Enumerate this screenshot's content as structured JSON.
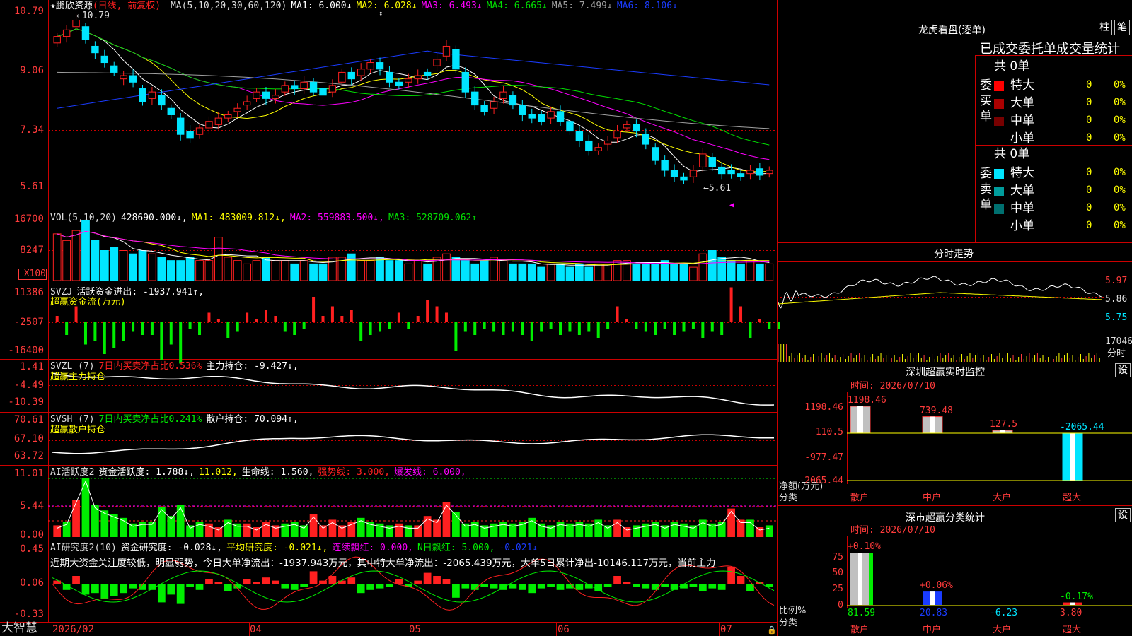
{
  "colors": {
    "up": "#ff2020",
    "down": "#00e5ff",
    "border": "#cc0000",
    "ma1": "#ffffff",
    "ma2": "#ffff00",
    "ma3": "#ff00ff",
    "ma4": "#00e000",
    "ma5": "#a0a0a0",
    "ma6": "#1a3cff",
    "green": "#00ee00",
    "red": "#ff2020",
    "yellow": "#ffff00",
    "magenta": "#ff00ff",
    "blue": "#1a3cff",
    "cyan": "#00e5ff"
  },
  "kline": {
    "title": "★鹏欣资源",
    "period": "(日线, 前复权)",
    "ma_params": "MA(5,10,20,30,60,120)",
    "ma_values": [
      {
        "label": "MA1: 6.000",
        "arrow": "↓",
        "color": "#ffffff"
      },
      {
        "label": "MA2: 6.028",
        "arrow": "↓",
        "color": "#ffff00"
      },
      {
        "label": "MA3: 6.493",
        "arrow": "↓",
        "color": "#ff00ff"
      },
      {
        "label": "MA4: 6.665",
        "arrow": "↓",
        "color": "#00e000"
      },
      {
        "label": "MA5: 7.499",
        "arrow": "↓",
        "color": "#a0a0a0"
      },
      {
        "label": "MA6: 8.106",
        "arrow": "↓",
        "color": "#1a3cff"
      }
    ],
    "yticks": [
      "10.79",
      "9.06",
      "7.34",
      "5.61"
    ],
    "high_label": "←10.79",
    "low_label": "←5.61",
    "price_min": 5.2,
    "price_max": 11.0,
    "closes": [
      10.1,
      10.3,
      10.6,
      10.0,
      9.6,
      9.3,
      9.0,
      8.9,
      8.7,
      8.1,
      8.4,
      8.0,
      7.7,
      7.1,
      7.0,
      7.3,
      7.5,
      7.6,
      7.7,
      7.9,
      8.1,
      8.4,
      8.2,
      8.3,
      8.6,
      8.5,
      8.7,
      8.4,
      8.3,
      8.6,
      9.0,
      8.8,
      9.1,
      9.3,
      9.1,
      8.7,
      8.6,
      8.8,
      8.9,
      8.9,
      9.4,
      9.8,
      9.1,
      8.4,
      8.0,
      7.8,
      8.1,
      8.4,
      8.0,
      7.7,
      7.6,
      7.5,
      7.8,
      7.5,
      7.2,
      6.9,
      6.6,
      6.7,
      6.9,
      7.2,
      7.4,
      7.2,
      6.8,
      6.3,
      6.0,
      5.8,
      5.7,
      6.0,
      6.5,
      6.1,
      5.9,
      5.9,
      5.8,
      6.0,
      5.85,
      6.0
    ],
    "opens": [
      9.9,
      10.1,
      10.4,
      10.4,
      9.8,
      9.5,
      9.2,
      8.8,
      8.9,
      8.5,
      8.2,
      8.3,
      7.9,
      7.6,
      7.2,
      7.1,
      7.3,
      7.4,
      7.6,
      7.8,
      8.0,
      8.2,
      8.4,
      8.2,
      8.4,
      8.6,
      8.5,
      8.7,
      8.5,
      8.4,
      8.7,
      9.0,
      8.9,
      9.1,
      9.3,
      9.0,
      8.7,
      8.7,
      8.8,
      9.0,
      9.2,
      9.5,
      9.7,
      9.0,
      8.4,
      8.0,
      7.9,
      8.2,
      8.3,
      8.0,
      7.7,
      7.7,
      7.6,
      7.8,
      7.5,
      7.2,
      6.9,
      6.6,
      6.8,
      7.0,
      7.3,
      7.4,
      7.1,
      6.7,
      6.3,
      6.0,
      5.8,
      5.8,
      6.1,
      6.4,
      6.1,
      6.0,
      5.9,
      5.9,
      6.05,
      5.9
    ]
  },
  "vol": {
    "header": [
      {
        "label": "VOL(5,10,20)",
        "color": "#dddddd"
      },
      {
        "label": "428690.000↓,",
        "color": "#ffffff"
      },
      {
        "label": "MA1: 483009.812↓,",
        "color": "#ffff00"
      },
      {
        "label": "MA2: 559883.500↓,",
        "color": "#ff00ff"
      },
      {
        "label": "MA3: 528709.062↑",
        "color": "#00e000"
      }
    ],
    "yticks": [
      "16700",
      "8247",
      "X100"
    ],
    "values": [
      14,
      12,
      15,
      18,
      12,
      9,
      10,
      9,
      8,
      9,
      8,
      7,
      6,
      6,
      7,
      6,
      6,
      13,
      7,
      6,
      5,
      6,
      7,
      6,
      6,
      5,
      6,
      5,
      5,
      7,
      7,
      8,
      6,
      6,
      7,
      6,
      6,
      5,
      6,
      5,
      7,
      8,
      7,
      6,
      5,
      6,
      7,
      6,
      5,
      5,
      5,
      4,
      5,
      5,
      4,
      5,
      4,
      5,
      5,
      6,
      6,
      5,
      5,
      5,
      6,
      5,
      5,
      4,
      8,
      9,
      7,
      6,
      5,
      6,
      5,
      5
    ]
  },
  "svzj": {
    "header": [
      {
        "label": "SVZJ",
        "color": "#dddddd"
      },
      {
        "label": "活跃资金进出: -1937.941↑,",
        "color": "#ffffff"
      }
    ],
    "subtitle": "超赢资金流(万元)",
    "yticks": [
      "11386",
      "-2507",
      "-16400"
    ],
    "values": [
      2,
      -4,
      5,
      -7,
      -6,
      -10,
      -8,
      -6,
      -3,
      -4,
      -4,
      -12,
      -7,
      -13,
      -2,
      -4,
      3,
      1,
      -5,
      -3,
      3,
      1,
      4,
      2,
      -3,
      -4,
      -2,
      8,
      2,
      5,
      2,
      4,
      -6,
      -4,
      -3,
      -2,
      3,
      -2,
      2,
      7,
      5,
      3,
      -9,
      -3,
      -4,
      -2,
      -3,
      -4,
      -3,
      -4,
      -6,
      -3,
      -2,
      -4,
      -3,
      -4,
      -3,
      -5,
      -2,
      5,
      1,
      -2,
      -3,
      -4,
      -2,
      -4,
      -3,
      -2,
      -5,
      -3,
      -4,
      11,
      5,
      -5,
      1,
      -2,
      -2
    ]
  },
  "svzl": {
    "header": [
      {
        "label": "SVZL (7)",
        "color": "#dddddd"
      },
      {
        "label": "7日内买卖净占比0.536%",
        "color": "#ff2020"
      },
      {
        "label": "主力持仓: -9.427↓,",
        "color": "#ffffff"
      }
    ],
    "subtitle": "超赢主力持仓",
    "yticks": [
      "1.41",
      "-4.49",
      "-10.39"
    ]
  },
  "svsh": {
    "header": [
      {
        "label": "SVSH (7)",
        "color": "#dddddd"
      },
      {
        "label": "7日内买卖净占比0.241%",
        "color": "#00ee00"
      },
      {
        "label": "散户持仓: 70.094↑,",
        "color": "#ffffff"
      }
    ],
    "subtitle": "超赢散户持仓",
    "yticks": [
      "70.61",
      "67.10",
      "63.72"
    ]
  },
  "ai_active": {
    "header": [
      {
        "label": "AI活跃度2",
        "color": "#dddddd"
      },
      {
        "label": "资金活跃度: 1.788↓,",
        "color": "#ffffff"
      },
      {
        "label": "11.012,",
        "color": "#ffff00"
      },
      {
        "label": "生命线: 1.560,",
        "color": "#ffffff"
      },
      {
        "label": "强势线: 3.000,",
        "color": "#ff2020"
      },
      {
        "label": "爆发线: 6.000,",
        "color": "#ff00ff"
      }
    ],
    "yticks": [
      "11.01",
      "5.44",
      "0.00"
    ]
  },
  "ai_research": {
    "header": [
      {
        "label": "AI研究度2(10)",
        "color": "#dddddd"
      },
      {
        "label": "资金研究度: -0.028↓,",
        "color": "#ffffff"
      },
      {
        "label": "平均研究度: -0.021↓,",
        "color": "#ffff00"
      },
      {
        "label": "连续飘红: 0.000,",
        "color": "#ff00ff"
      },
      {
        "label": "N日飘红: 5.000,",
        "color": "#00ee00"
      },
      {
        "label": "-0.021↓",
        "color": "#1a3cff"
      }
    ],
    "comment": "近期大资金关注度较低，明显弱势，今日大单净流出：-1937.943万元，其中特大单净流出：-2065.439万元，大单5日累计净出-10146.117万元，当前主力",
    "yticks": [
      "0.45",
      "0.06",
      "-0.33"
    ]
  },
  "xaxis": {
    "labels": [
      "2026/02",
      "04",
      "05",
      "06",
      "07"
    ]
  },
  "logo": "大智慧",
  "right": {
    "longhu": {
      "title": "龙虎看盘(逐单)",
      "btn1": "柱",
      "btn2": "笔",
      "subtitle": "已成交委托单成交量统计",
      "buy": {
        "label": "委买单",
        "total": "共 0单",
        "rows": [
          {
            "name": "特大",
            "val": "0",
            "pct": "0%",
            "color": "#ff0000"
          },
          {
            "name": "大单",
            "val": "0",
            "pct": "0%",
            "color": "#aa0000"
          },
          {
            "name": "中单",
            "val": "0",
            "pct": "0%",
            "color": "#770000"
          },
          {
            "name": "小单",
            "val": "0",
            "pct": "0%",
            "color": "#000000"
          }
        ]
      },
      "sell": {
        "label": "委卖单",
        "total": "共 0单",
        "rows": [
          {
            "name": "特大",
            "val": "0",
            "pct": "0%",
            "color": "#00e5ff"
          },
          {
            "name": "大单",
            "val": "0",
            "pct": "0%",
            "color": "#009c9c"
          },
          {
            "name": "中单",
            "val": "0",
            "pct": "0%",
            "color": "#007070"
          },
          {
            "name": "小单",
            "val": "0",
            "pct": "0%",
            "color": "#000000"
          }
        ]
      }
    },
    "intraday": {
      "title": "分时走势",
      "yticks": [
        "5.97",
        "5.86",
        "5.75"
      ],
      "vol_label": "17046",
      "label": "分时"
    },
    "monitor": {
      "title": "深圳超赢实时监控",
      "btn": "设",
      "time": "时间: 2026/07/10",
      "yticks": [
        "1198.46",
        "110.5",
        "-977.47",
        "-2065.44"
      ],
      "ylabel1": "净额(万元)",
      "ylabel2": "分类",
      "categories": [
        "散户",
        "中户",
        "大户",
        "超大"
      ],
      "values": [
        1198.46,
        739.48,
        127.5,
        -2065.44
      ],
      "value_labels": [
        "1198.46",
        "739.48",
        "127.5",
        "-2065.44"
      ]
    },
    "stats": {
      "title": "深市超赢分类统计",
      "btn": "设",
      "time": "时间: 2026/07/10",
      "yticks": [
        "75",
        "50",
        "25",
        "0"
      ],
      "ylabel1": "比例%",
      "ylabel2": "分类",
      "categories": [
        "散户",
        "中户",
        "大户",
        "超大"
      ],
      "values": [
        81.59,
        20.83,
        -6.23,
        3.8
      ],
      "value_labels": [
        "81.59",
        "20.83",
        "-6.23",
        "3.80"
      ],
      "change_labels": [
        "+0.10%",
        "+0.06%",
        "",
        "-0.17%"
      ]
    }
  }
}
